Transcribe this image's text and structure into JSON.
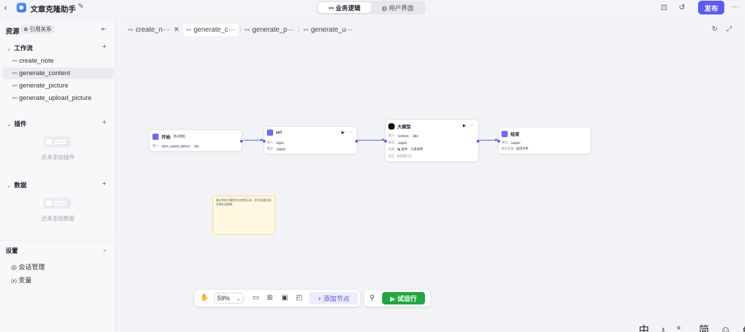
{
  "header": {
    "back_icon": "‹",
    "app_name": "文章克隆助手",
    "edit_icon": "✎",
    "modes": [
      "⚯ 业务逻辑",
      "◍ 用户界面"
    ],
    "publish_label": "发布",
    "more_icon": "···"
  },
  "sidebar": {
    "resources_title": "资源",
    "ref_tag": "⊕ 引用关系",
    "workflow_section": "工作流",
    "workflows": [
      "create_note",
      "generate_content",
      "generate_picture",
      "generate_upload_picture"
    ],
    "plugin_section": "插件",
    "plugin_empty": "还未添加插件",
    "data_section": "数据",
    "data_empty": "还未添加数据",
    "settings_title": "设置",
    "settings_items": [
      "会话管理",
      "变量"
    ],
    "settings_icons": [
      "◎",
      "(x)"
    ]
  },
  "tabs": [
    "create_n···",
    "generate_c···",
    "generate_p···",
    "generate_u···"
  ],
  "nodes": {
    "start": {
      "title": "开始",
      "badge": "默认数据",
      "input_label": "输入",
      "inputs": [
        "BOT_USER_INPUT",
        "file"
      ]
    },
    "url": {
      "title": "url",
      "input_label": "输入",
      "input": "input",
      "output_label": "输出",
      "output": "output"
    },
    "llm": {
      "title": "大模型",
      "input_label": "输入",
      "inputs": [
        "content",
        "title"
      ],
      "output_label": "输出",
      "output": "output",
      "skill_label": "技能",
      "skill": "🔌 插件 · 工具调用",
      "memory_label": "记忆",
      "memory": "未配置记忆"
    },
    "end": {
      "title": "结束",
      "output_label": "输出",
      "output": "output",
      "answer_label": "输出变量",
      "answer": "返回文本"
    }
  },
  "note": {
    "text": "通过将各大模型节点的提示词，即可快速实现文章生成效果"
  },
  "toolbar": {
    "zoom": "59%",
    "add_node": "+ 添加节点",
    "run": "▶ 试运行"
  },
  "ime": "中 ♪ °, 简 ☺ ⚙"
}
